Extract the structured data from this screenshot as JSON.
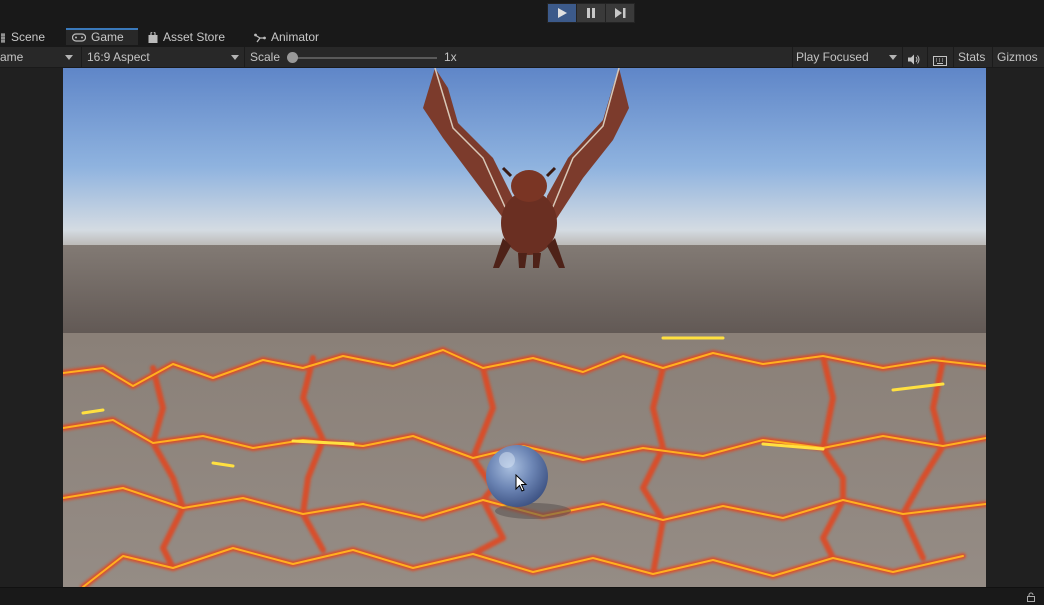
{
  "tabs": [
    {
      "label": "Scene",
      "icon": "scene-grid-icon"
    },
    {
      "label": "Game",
      "icon": "gamepad-icon"
    },
    {
      "label": "Asset Store",
      "icon": "shopping-bag-icon"
    },
    {
      "label": "Animator",
      "icon": "animator-icon"
    }
  ],
  "toolbar": {
    "display": "ame",
    "aspect": "16:9 Aspect",
    "scale_label": "Scale",
    "scale_value": "1x",
    "play_mode": "Play Focused",
    "stats": "Stats",
    "gizmos": "Gizmos"
  },
  "play_controls": {
    "play_icon": "play-icon",
    "pause_icon": "pause-icon",
    "step_icon": "step-icon",
    "play_active": true
  },
  "colors": {
    "accent": "#3a79bb",
    "play_active": "#3c5a8a",
    "sky_top": "#5f86c8",
    "sky_horizon": "#d8dde2",
    "ground": "#6b6460",
    "lava": "#ff6a10",
    "rock": "#8c8780"
  },
  "scene": {
    "objects": [
      "dragon",
      "sphere",
      "lava-ground"
    ]
  }
}
